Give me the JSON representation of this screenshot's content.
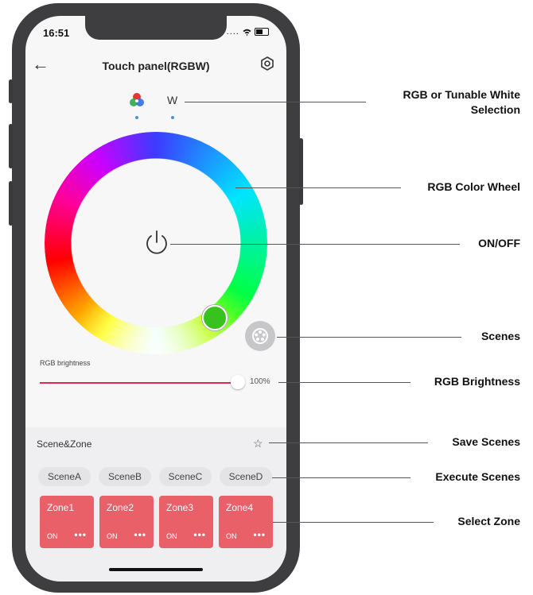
{
  "status_bar": {
    "time": "16:51",
    "signal": "....",
    "wifi_icon": "wifi-icon"
  },
  "header": {
    "title": "Touch panel(RGBW)"
  },
  "mode_selector": {
    "rgb_icon": "rgb-palette-icon",
    "white_label": "W"
  },
  "brightness": {
    "label": "RGB brightness",
    "value": "100%",
    "level": 1.0
  },
  "scene_zone": {
    "label": "Scene&Zone",
    "scenes": [
      "SceneA",
      "SceneB",
      "SceneC",
      "SceneD"
    ],
    "zones": [
      {
        "name": "Zone1",
        "state": "ON",
        "more": "•••"
      },
      {
        "name": "Zone2",
        "state": "ON",
        "more": "•••"
      },
      {
        "name": "Zone3",
        "state": "ON",
        "more": "•••"
      },
      {
        "name": "Zone4",
        "state": "ON",
        "more": "•••"
      }
    ]
  },
  "callouts": {
    "mode": "RGB or Tunable White Selection",
    "wheel": "RGB Color Wheel",
    "power": "ON/OFF",
    "scenes": "Scenes",
    "brightness": "RGB Brightness",
    "save": "Save Scenes",
    "execute": "Execute Scenes",
    "zone": "Select Zone"
  },
  "colors": {
    "accent": "#e0294f",
    "zone_bg": "#ea6069",
    "phone": "#3e3e41"
  }
}
